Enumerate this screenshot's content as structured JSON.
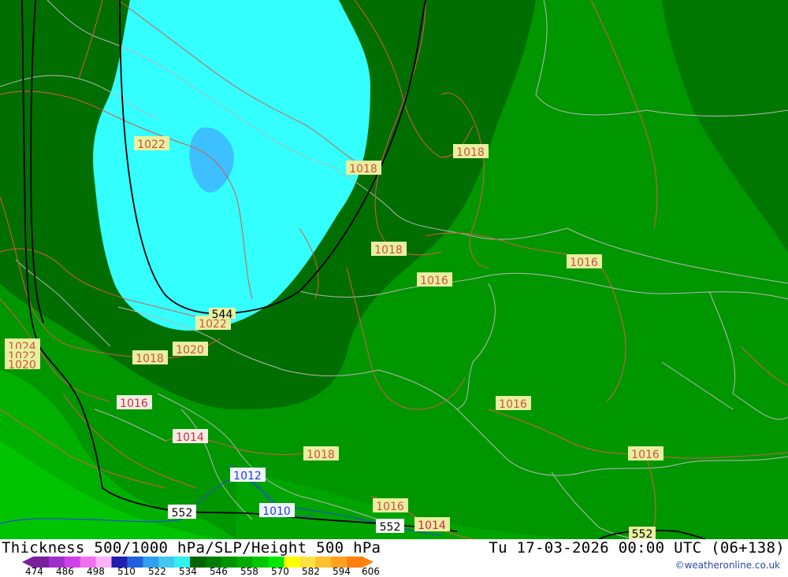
{
  "title": "Thickness 500/1000 hPa/SLP/Height 500 hPa",
  "valid_time": "Tu 17-03-2026 00:00 UTC (06+138)",
  "credit": "©weatheronline.co.uk",
  "legend": {
    "ticks": [
      "474",
      "486",
      "498",
      "510",
      "522",
      "534",
      "546",
      "558",
      "570",
      "582",
      "594",
      "606"
    ],
    "colors": [
      "#7a1f9e",
      "#a030c8",
      "#d040e8",
      "#f070f0",
      "#ffb0f8",
      "#2020b0",
      "#2060e0",
      "#30a0f0",
      "#40c8f0",
      "#30f0f0",
      "#006400",
      "#007c00",
      "#009400",
      "#00ac00",
      "#00c800",
      "#00e800",
      "#ffff00",
      "#ffe040",
      "#ffc030",
      "#ffa020",
      "#ff8010"
    ]
  },
  "pressure_labels": [
    "1022",
    "1018",
    "1018",
    "1018",
    "1016",
    "1016",
    "1022",
    "1020",
    "1018",
    "1024",
    "1022",
    "1020",
    "1016",
    "1014",
    "1016",
    "1018",
    "1016",
    "1012",
    "1010",
    "1016",
    "1014"
  ],
  "height_labels": [
    "544",
    "552",
    "552",
    "552"
  ]
}
